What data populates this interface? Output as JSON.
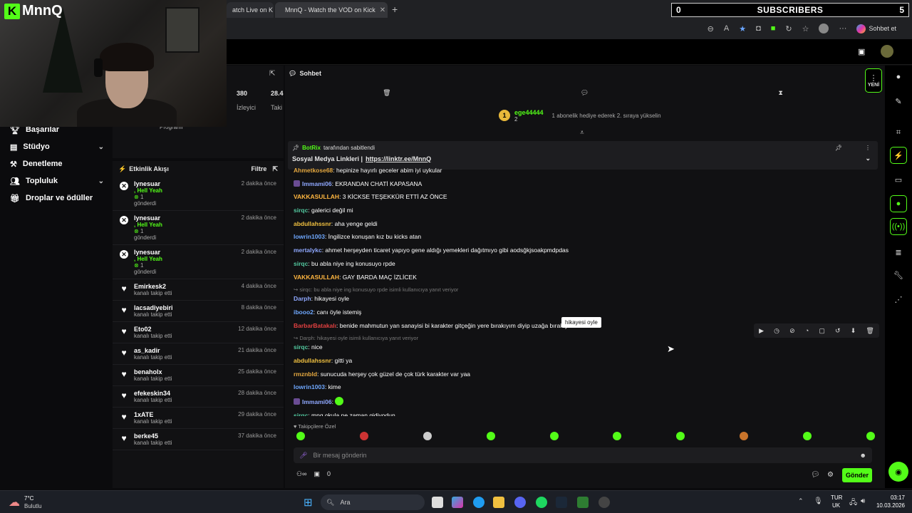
{
  "stream_overlay": {
    "subscribers_count": "0",
    "subscribers_label": "SUBSCRIBERS",
    "subscribers_goal": "5",
    "logo_text": "MnnQ"
  },
  "browser": {
    "tabs": [
      {
        "title": "atch Live on K"
      },
      {
        "title": "MnnQ - Watch the VOD on Kick"
      }
    ],
    "sohbet_et": "Sohbet et"
  },
  "left_nav": {
    "items": [
      {
        "label": "Başarılar",
        "icon": "trophy-icon"
      },
      {
        "label": "Stüdyo",
        "icon": "studio-icon",
        "expandable": true
      },
      {
        "label": "Denetleme",
        "icon": "gavel-icon"
      },
      {
        "label": "Topluluk",
        "icon": "users-icon",
        "expandable": true
      },
      {
        "label": "Droplar ve ödüller",
        "icon": "gift-icon"
      }
    ]
  },
  "stats": {
    "viewers_value": "380",
    "viewers_label": "İzleyici",
    "followers_value": "28.4",
    "followers_label": "Taki",
    "program_label": "Programı"
  },
  "activity": {
    "title": "Etkinlik Akışı",
    "filter_label": "Filtre",
    "events": [
      {
        "name": "lynesuar",
        "line2": ", Hell Yeah",
        "line3": "1",
        "line4": "gönderdi",
        "time": "2 dakika önce",
        "kind": "gift"
      },
      {
        "name": "lynesuar",
        "line2": ", Hell Yeah",
        "line3": "1",
        "line4": "gönderdi",
        "time": "2 dakika önce",
        "kind": "gift"
      },
      {
        "name": "lynesuar",
        "line2": ", Hell Yeah",
        "line3": "1",
        "line4": "gönderdi",
        "time": "2 dakika önce",
        "kind": "gift"
      },
      {
        "name": "Emirkesk2",
        "line2": "kanalı takip etti",
        "time": "4 dakika önce",
        "kind": "follow"
      },
      {
        "name": "lacsadiyebiri",
        "line2": "kanalı takip etti",
        "time": "8 dakika önce",
        "kind": "follow"
      },
      {
        "name": "Eto02",
        "line2": "kanalı takip etti",
        "time": "12 dakika önce",
        "kind": "follow"
      },
      {
        "name": "as_kadir",
        "line2": "kanalı takip etti",
        "time": "21 dakika önce",
        "kind": "follow"
      },
      {
        "name": "benaholx",
        "line2": "kanalı takip etti",
        "time": "25 dakika önce",
        "kind": "follow"
      },
      {
        "name": "efekeskin34",
        "line2": "kanalı takip etti",
        "time": "28 dakika önce",
        "kind": "follow"
      },
      {
        "name": "1xATE",
        "line2": "kanalı takip etti",
        "time": "29 dakika önce",
        "kind": "follow"
      },
      {
        "name": "berke45",
        "line2": "kanalı takip etti",
        "time": "37 dakika önce",
        "kind": "follow"
      }
    ]
  },
  "chat": {
    "title": "Sohbet",
    "yeni": "YENİ",
    "gift_user": "ege44444",
    "gift_count": "2",
    "gift_rank": "1",
    "gift_text": "1 abonelik hediye ederek 2. sıraya yükselin",
    "pinned_by": "BotRix",
    "pinned_suffix": "tarafından sabitlendi",
    "pinned_text": "Sosyal Medya Linkleri |",
    "pinned_link": "https://linktr.ee/MnnQ",
    "messages": [
      {
        "user": "Ahmetkose68",
        "color": "#e6a940",
        "text": ": hepinize hayırlı geceler abim iyi uykular"
      },
      {
        "user": "Immami06",
        "color": "#8fa8ff",
        "text": ": EKRANDAN CHATİ KAPASANA",
        "badge": true
      },
      {
        "user": "VAKKASULLAH",
        "color": "#ffb640",
        "text": ": 3 KİCKSE TEŞEKKÜR ETTİ AZ ÖNCE"
      },
      {
        "user": "sirqc",
        "color": "#53c9a0",
        "text": ": galerici değil mi"
      },
      {
        "user": "abdullahssnr",
        "color": "#f0c040",
        "text": ": aha yenge geldi"
      },
      {
        "user": "lowrin1003",
        "color": "#6fa8ff",
        "text": ": İngilizce konuşan kız bu kicks atan"
      },
      {
        "user": "mertalykc",
        "color": "#8fa8ff",
        "text": ": ahmet herşeyden ticaret yapıyo gene aldığı yemekleri dağıtmıyo gibi aodsğkjsoakpmdpdas"
      },
      {
        "user": "sirqc",
        "color": "#53c9a0",
        "text": ": bu abla niye ing konusuyo rpde"
      },
      {
        "user": "VAKKASULLAH",
        "color": "#ffb640",
        "text": ": GAY BARDA MAÇ İZLİCEK"
      },
      {
        "reply": "↪ sirqc: bu abla niye ing konusuyo rpde isimli kullanıcıya yanıt veriyor",
        "user": "Darph",
        "color": "#8fa8ff",
        "text": ": hikayesi oyle"
      },
      {
        "user": "ibooo2",
        "color": "#6fa8ff",
        "text": ": canı öyle istemiş"
      },
      {
        "user": "BarbarBatakalı",
        "color": "#e04040",
        "text": ": benide mahmutun yan sanayisi bi karakter gitçeğin yere bırakıyım diyip uzağa bırakıyı"
      },
      {
        "reply": "↪ Darph: hikayesi oyle isimli kullanıcıya yanıt veriyor",
        "user": "sirqc",
        "color": "#53c9a0",
        "text": ": nice"
      },
      {
        "user": "abdullahssnr",
        "color": "#f0c040",
        "text": ": gitti ya"
      },
      {
        "user": "rmznbld",
        "color": "#e6a940",
        "text": ": sunucuda herşey çok güzel de çok türk karakter var yaa"
      },
      {
        "user": "lowrin1003",
        "color": "#6fa8ff",
        "text": ": kime"
      },
      {
        "user": "Immami06",
        "color": "#8fa8ff",
        "text": ":",
        "badge": true
      },
      {
        "user": "sirqc",
        "color": "#53c9a0",
        "text": ": mnq okula ne zaman gidiyodun"
      }
    ],
    "followers_only": "Takipçilere Özel",
    "tooltip": "hikayesi oyle",
    "input_placeholder": "Bir mesaj gönderin",
    "send_label": "Gönder",
    "points": "0"
  },
  "taskbar": {
    "weather_temp": "7°C",
    "weather_desc": "Bulutlu",
    "search_label": "Ara",
    "lang": "TUR",
    "region": "UK",
    "time": "03:17",
    "date": "10.03.2026"
  },
  "colors": {
    "kick_green": "#53fc18",
    "panel": "#111113",
    "background": "#0b0b0d"
  }
}
